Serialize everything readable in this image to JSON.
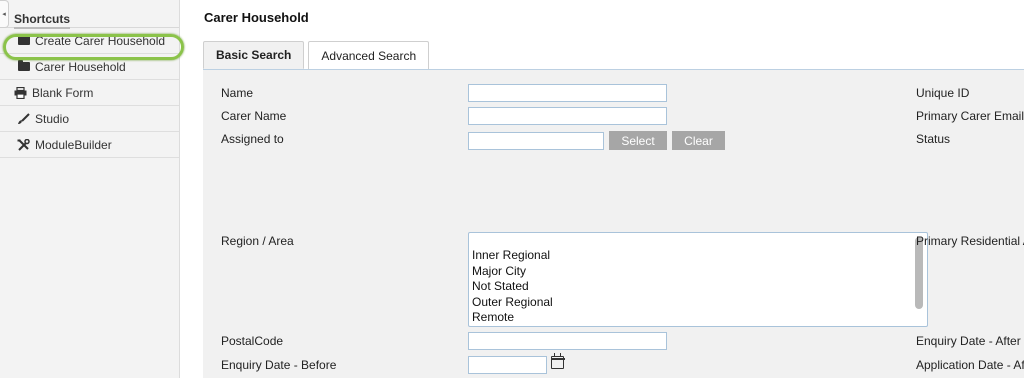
{
  "sidebar": {
    "collapse_glyph": "◂",
    "header": "Shortcuts",
    "items": [
      {
        "label": "Create Carer Household",
        "icon": "folder-icon"
      },
      {
        "label": "Carer Household",
        "icon": "folder-icon"
      },
      {
        "label": "Blank Form",
        "icon": "print-icon"
      },
      {
        "label": "Studio",
        "icon": "brush-icon"
      },
      {
        "label": "ModuleBuilder",
        "icon": "tools-icon"
      }
    ]
  },
  "page": {
    "title": "Carer Household"
  },
  "tabs": [
    {
      "label": "Basic Search",
      "active": true
    },
    {
      "label": "Advanced Search",
      "active": false
    }
  ],
  "form": {
    "name_label": "Name",
    "carer_name_label": "Carer Name",
    "assigned_to_label": "Assigned to",
    "select_button": "Select",
    "clear_button": "Clear",
    "region_label": "Region / Area",
    "region_options": [
      "Inner Regional",
      "Major City",
      "Not Stated",
      "Outer Regional",
      "Remote"
    ],
    "postal_code_label": "PostalCode",
    "enquiry_before_label": "Enquiry Date - Before",
    "unique_id_label": "Unique ID",
    "primary_email_label": "Primary Carer Email",
    "status_label": "Status",
    "primary_residential_label": "Primary Residential Address",
    "enquiry_after_label": "Enquiry Date - After",
    "application_after_label": "Application Date - After"
  },
  "colors": {
    "highlight_ring": "#8bc34a",
    "button_bg": "#a6a6a6",
    "input_border": "#a9c3da"
  }
}
